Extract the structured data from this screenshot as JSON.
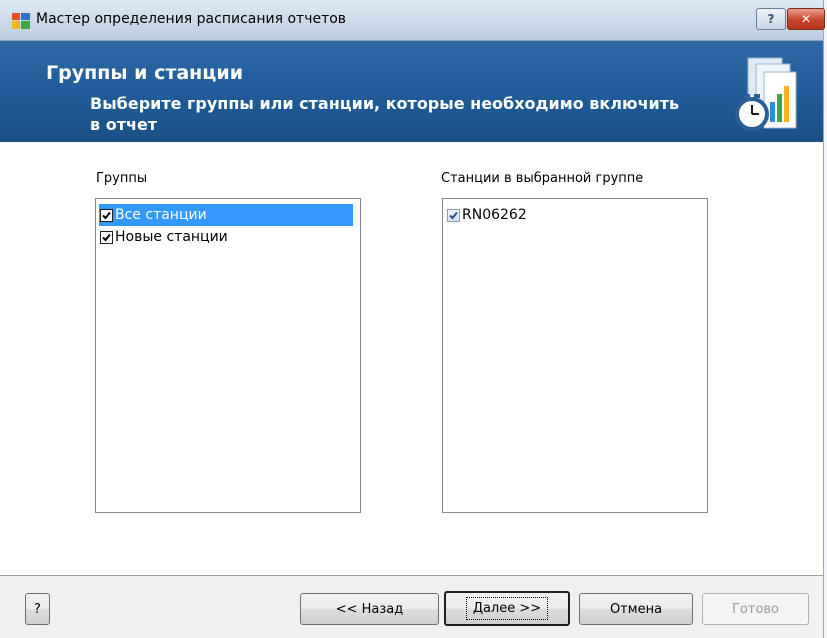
{
  "window": {
    "title": "Мастер определения расписания отчетов",
    "help_label": "?",
    "close_label": "✕"
  },
  "header": {
    "title": "Группы и станции",
    "subtitle": "Выберите группы или станции, которые необходимо включить в отчет",
    "icon": "report-schedule-clock-icon"
  },
  "groups": {
    "label": "Группы",
    "items": [
      {
        "label": "Все станции",
        "checked": true,
        "selected": true
      },
      {
        "label": "Новые станции",
        "checked": true,
        "selected": false
      }
    ]
  },
  "stations": {
    "label": "Станции в выбранной группе",
    "items": [
      {
        "label": "RN06262",
        "checked": true
      }
    ]
  },
  "footer": {
    "help_label": "?",
    "back_label": "<< Назад",
    "next_label": "Далее >>",
    "cancel_label": "Отмена",
    "finish_label": "Готово"
  },
  "colors": {
    "header_bg": "#1f5a96",
    "selection": "#3399ff"
  }
}
